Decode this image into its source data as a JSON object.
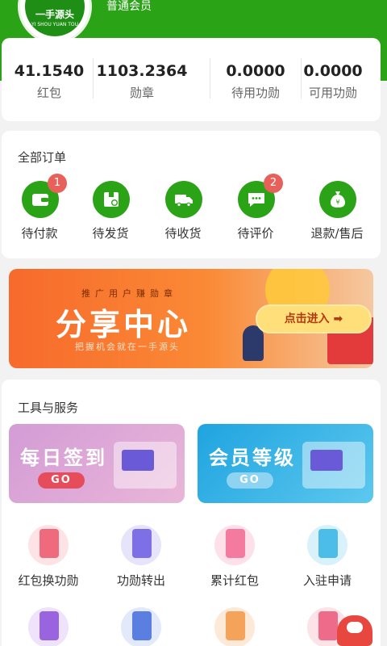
{
  "header": {
    "logo_text": "一手源头",
    "logo_sub": "YI SHOU YUAN TOU",
    "member_level": "普通会员"
  },
  "stats": [
    {
      "value": "41.1540",
      "label": "红包"
    },
    {
      "value": "1103.2364",
      "label": "勋章"
    },
    {
      "value": "0.0000",
      "label": "待用功勋"
    },
    {
      "value": "0.0000",
      "label": "可用功勋"
    }
  ],
  "orders": {
    "title": "全部订单",
    "items": [
      {
        "label": "待付款",
        "badge": "1",
        "icon": "wallet-icon"
      },
      {
        "label": "待发货",
        "badge": "",
        "icon": "package-clock-icon"
      },
      {
        "label": "待收货",
        "badge": "",
        "icon": "truck-icon"
      },
      {
        "label": "待评价",
        "badge": "2",
        "icon": "chat-icon"
      },
      {
        "label": "退款/售后",
        "badge": "",
        "icon": "money-bag-icon"
      }
    ]
  },
  "banner": {
    "slogan": "推广用户赚勋章",
    "title": "分享中心",
    "subtitle": "把握机会就在一手源头",
    "button": "点击进入 ➡"
  },
  "tools": {
    "title": "工具与服务",
    "promos": [
      {
        "title": "每日签到",
        "button": "GO"
      },
      {
        "title": "会员等级",
        "button": "GO"
      }
    ],
    "services": [
      {
        "label": "红包换功勋",
        "icon": "gift-icon"
      },
      {
        "label": "功勋转出",
        "icon": "coin-transfer-icon"
      },
      {
        "label": "累计红包",
        "icon": "yuan-envelope-icon"
      },
      {
        "label": "入驻申请",
        "icon": "location-pin-icon"
      },
      {
        "label": "",
        "icon": "star-card-icon"
      },
      {
        "label": "",
        "icon": "list-document-icon"
      },
      {
        "label": "",
        "icon": "note-pencil-icon"
      },
      {
        "label": "",
        "icon": "calendar-icon"
      }
    ]
  },
  "colors": {
    "brand_green": "#2aa316",
    "badge_red": "#e8605a",
    "banner_orange": "#f76a2b"
  }
}
